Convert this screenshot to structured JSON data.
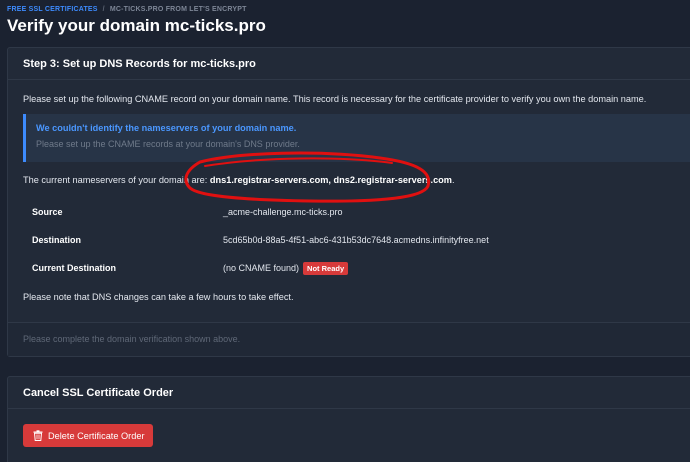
{
  "breadcrumb": {
    "item1": "FREE SSL CERTIFICATES",
    "separator": "/",
    "item2": "MC-TICKS.PRO FROM LET'S ENCRYPT"
  },
  "page_title": "Verify your domain mc-ticks.pro",
  "step_card": {
    "header": "Step 3: Set up DNS Records for mc-ticks.pro",
    "intro": "Please set up the following CNAME record on your domain name. This record is necessary for the certificate provider to verify you own the domain name.",
    "alert": {
      "title": "We couldn't identify the nameservers of your domain name.",
      "text": "Please set up the CNAME records at your domain's DNS provider."
    },
    "nameservers_prefix": "The current nameservers of your domain are:",
    "nameservers_value": "dns1.registrar-servers.com, dns2.registrar-servers.com",
    "nameservers_suffix": ".",
    "records": [
      {
        "label": "Source",
        "value": "_acme-challenge.mc-ticks.pro"
      },
      {
        "label": "Destination",
        "value": "5cd65b0d-88a5-4f51-abc6-431b53dc7648.acmedns.infinityfree.net"
      },
      {
        "label": "Current Destination",
        "value": "(no CNAME found)",
        "badge": "Not Ready"
      }
    ],
    "note": "Please note that DNS changes can take a few hours to take effect.",
    "footer": "Please complete the domain verification shown above."
  },
  "cancel_card": {
    "header": "Cancel SSL Certificate Order",
    "button_label": "Delete Certificate Order",
    "button_icon": "trash-icon"
  },
  "colors": {
    "background": "#1b2230",
    "card": "#222a38",
    "accent": "#3d8bfd",
    "danger": "#d73a3a",
    "annotation": "#e01010"
  }
}
